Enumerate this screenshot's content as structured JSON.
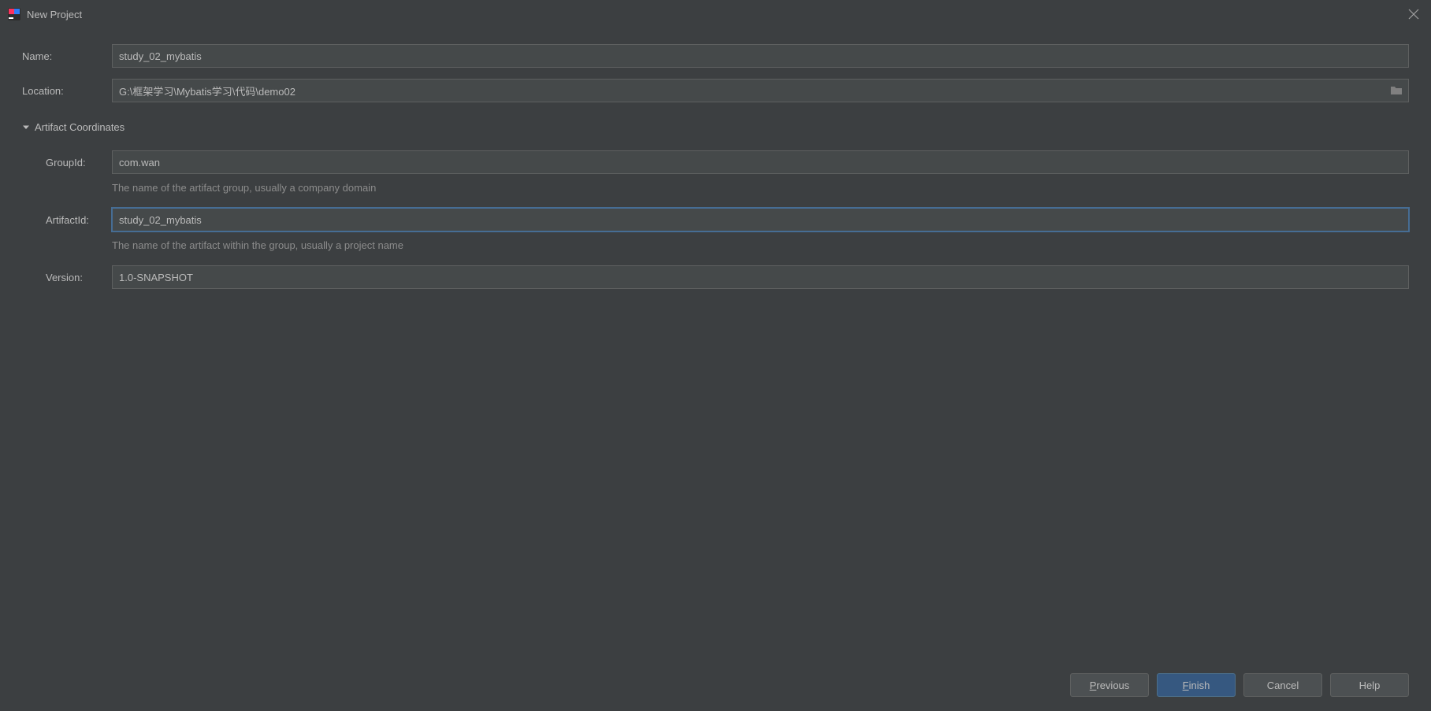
{
  "window": {
    "title": "New Project"
  },
  "form": {
    "name_label": "Name:",
    "name_value": "study_02_mybatis",
    "location_label": "Location:",
    "location_value": "G:\\框架学习\\Mybatis学习\\代码\\demo02",
    "artifact_section_label": "Artifact Coordinates",
    "groupid_label": "GroupId:",
    "groupid_value": "com.wan",
    "groupid_hint": "The name of the artifact group, usually a company domain",
    "artifactid_label": "ArtifactId:",
    "artifactid_value": "study_02_mybatis",
    "artifactid_hint": "The name of the artifact within the group, usually a project name",
    "version_label": "Version:",
    "version_value": "1.0-SNAPSHOT"
  },
  "buttons": {
    "previous": "Previous",
    "finish": "Finish",
    "cancel": "Cancel",
    "help": "Help"
  }
}
